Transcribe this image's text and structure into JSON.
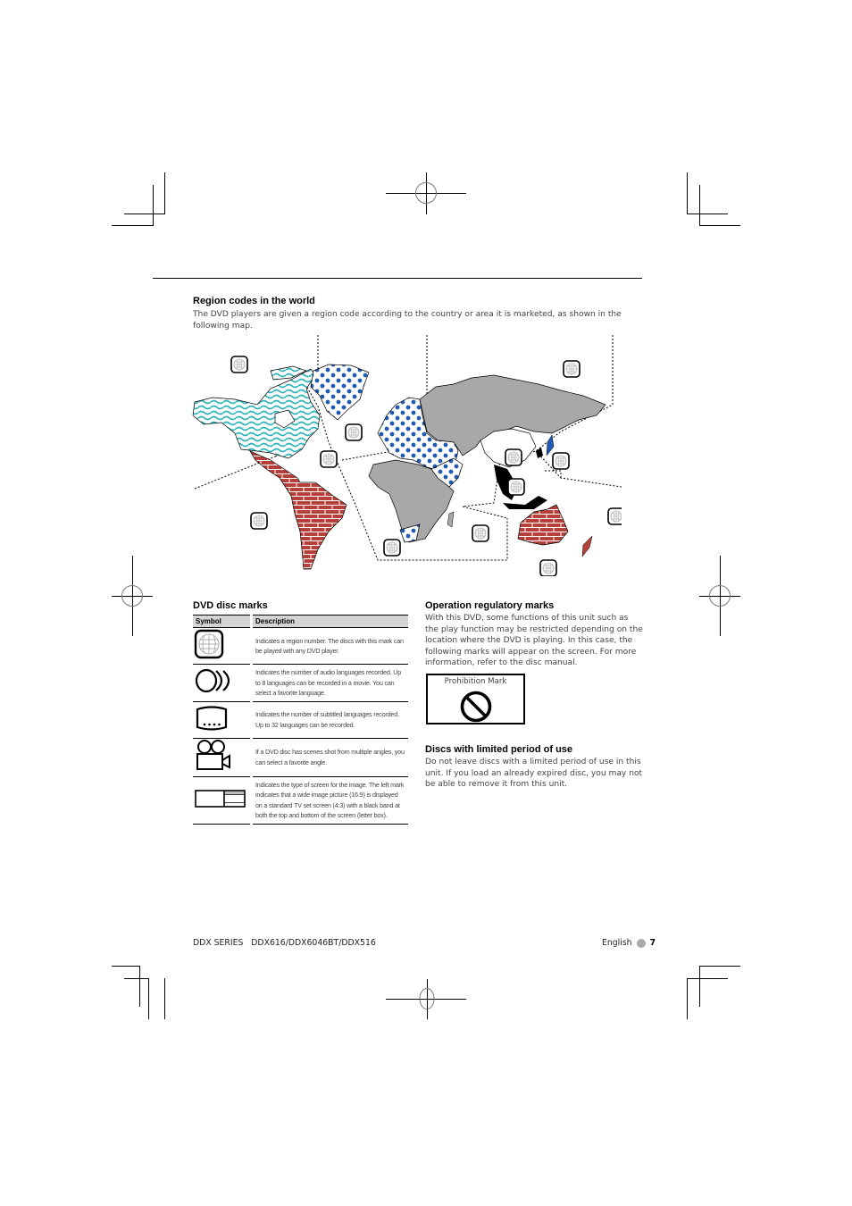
{
  "region_section": {
    "title": "Region codes in the world",
    "description": "The DVD players are given a region code according to the country or area it is marketed, as shown in the following map."
  },
  "map": {
    "region_icon": "globe-region-icon",
    "legend_colors": {
      "region1_north_america": "#2ab3b8",
      "region2_europe_japan": "#1f5bb5",
      "region3_southeast_asia": "#000000",
      "region4_latin_america_oceania": "#b5403a",
      "region5_africa_russia_india": "#a8a8a8",
      "region6_china": "#ffffff"
    }
  },
  "disc_marks": {
    "title": "DVD disc marks",
    "headers": {
      "symbol": "Symbol",
      "description": "Description"
    },
    "rows": [
      {
        "icon": "region-globe-icon",
        "description": "Indicates a region number. The discs with this mark can be played with any DVD player."
      },
      {
        "icon": "audio-languages-icon",
        "description": "Indicates the number of audio languages recorded. Up to 8 languages can be recorded in a movie. You can select a favorite language."
      },
      {
        "icon": "subtitle-languages-icon",
        "description": "Indicates the number of subtitled languages recorded. Up to 32 languages can be recorded."
      },
      {
        "icon": "multi-angle-camera-icon",
        "description": "If a DVD disc has scenes shot from multiple angles, you can select a favorite angle."
      },
      {
        "icon": "screen-type-icon",
        "description": "Indicates the type of screen for the image. The left mark indicates that a wide image picture (16:9) is displayed on a standard TV set screen (4:3) with a black band at both the top and bottom of the screen (letter box)."
      }
    ]
  },
  "operation_marks": {
    "title": "Operation regulatory marks",
    "description": "With this DVD, some functions of this unit such as the play function may be restricted depending on the location where the DVD is playing. In this case, the following marks will appear on the screen. For more information, refer to the disc manual.",
    "prohibition_label": "Prohibition Mark",
    "prohibition_icon": "prohibition-icon"
  },
  "limited_discs": {
    "title": "Discs with limited period of use",
    "description": "Do not leave discs with a limited period of use in this unit. If you load an already expired disc, you may not be able to remove it from this unit."
  },
  "footer": {
    "series": "DDX SERIES   DDX616/DDX6046BT/DDX516",
    "language": "English",
    "page_number": "7"
  }
}
